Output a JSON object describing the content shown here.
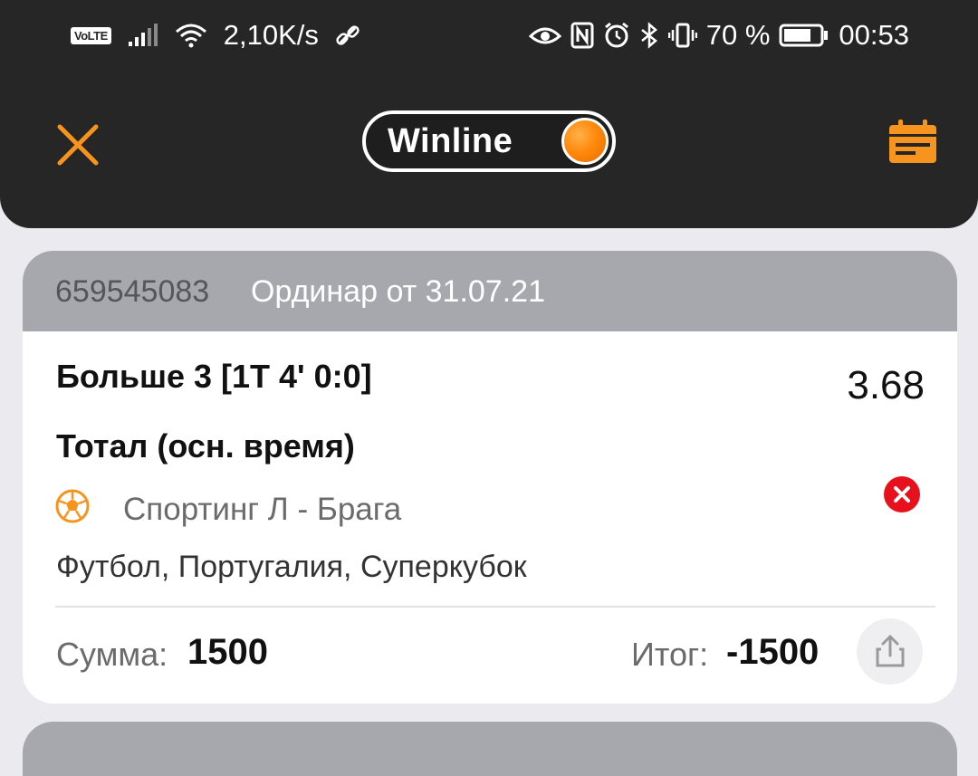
{
  "status_bar": {
    "network_badge": "VoLTE",
    "speed": "2,10K/s",
    "battery": "70 %",
    "time": "00:53"
  },
  "header": {
    "brand": "Winline",
    "close_icon": "close-icon",
    "calendar_icon": "calendar-icon"
  },
  "bet": {
    "id": "659545083",
    "type_date": "Ординар от 31.07.21",
    "outcome": "Больше 3 [1Т 4' 0:0]",
    "odds": "3.68",
    "market": "Тотал (осн. время)",
    "event": "Спортинг Л - Брага",
    "league": "Футбол, Португалия, Суперкубок",
    "sum_label": "Сумма:",
    "sum_value": "1500",
    "total_label": "Итог:",
    "total_value": "-1500",
    "status": "lost"
  },
  "colors": {
    "accent": "#f7941d",
    "header_bg": "#262626",
    "card_header_bg": "#a7a8ad",
    "lost_red": "#e8101c"
  }
}
